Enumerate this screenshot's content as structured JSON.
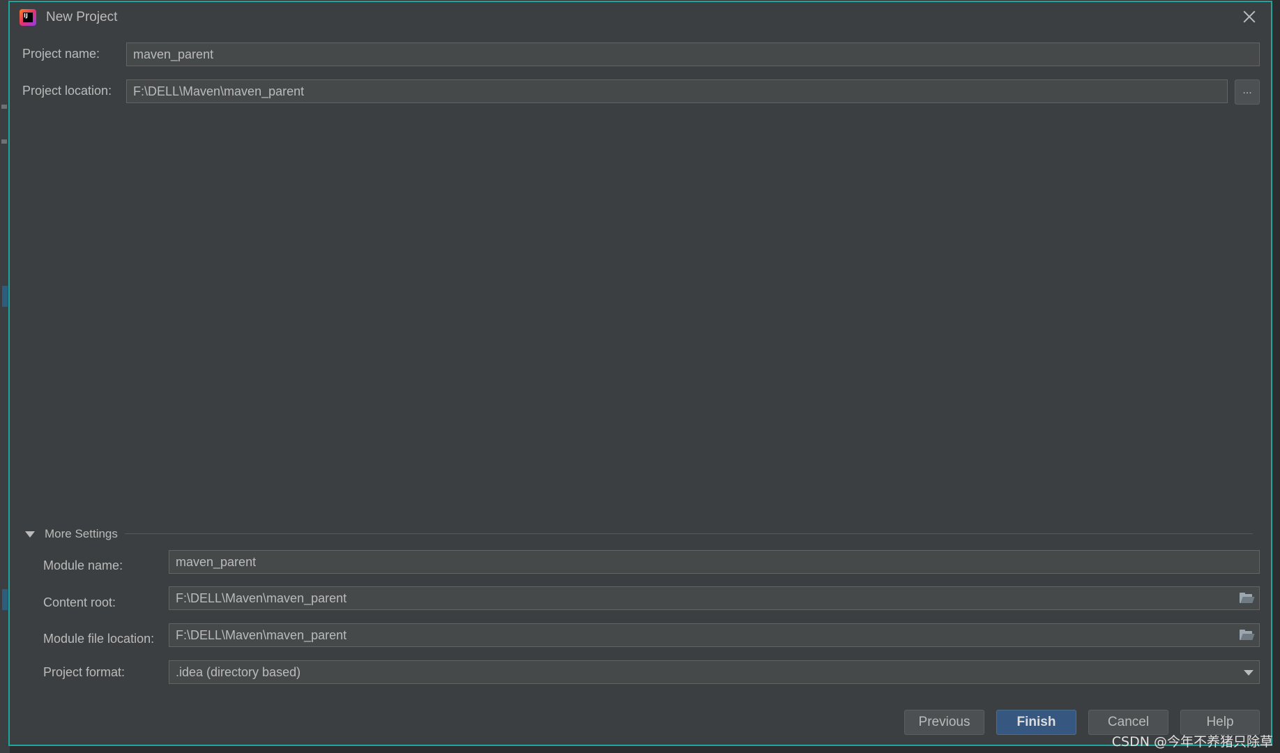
{
  "window": {
    "title": "New Project"
  },
  "project": {
    "name_label": "Project name:",
    "name_value": "maven_parent",
    "location_label": "Project location:",
    "location_value": "F:\\DELL\\Maven\\maven_parent",
    "browse_label": "..."
  },
  "more_settings": {
    "header": "More Settings",
    "module_name_label": "Module name:",
    "module_name_value": "maven_parent",
    "content_root_label": "Content root:",
    "content_root_value": "F:\\DELL\\Maven\\maven_parent",
    "module_file_label": "Module file location:",
    "module_file_value": "F:\\DELL\\Maven\\maven_parent",
    "format_label": "Project format:",
    "format_value": ".idea (directory based)"
  },
  "buttons": {
    "previous": "Previous",
    "finish": "Finish",
    "cancel": "Cancel",
    "help": "Help"
  },
  "watermark": "CSDN @今年不养猪只除草",
  "colors": {
    "dialog_bg": "#3c3f41",
    "border_accent": "#1fa59b",
    "field_bg": "#45494a",
    "primary_button": "#365880",
    "text": "#bbbbbb"
  },
  "icons": {
    "app": "intellij-idea-icon",
    "close": "close-icon",
    "folder": "folder-icon",
    "dropdown": "chevron-down-icon",
    "collapse": "triangle-down-icon"
  }
}
